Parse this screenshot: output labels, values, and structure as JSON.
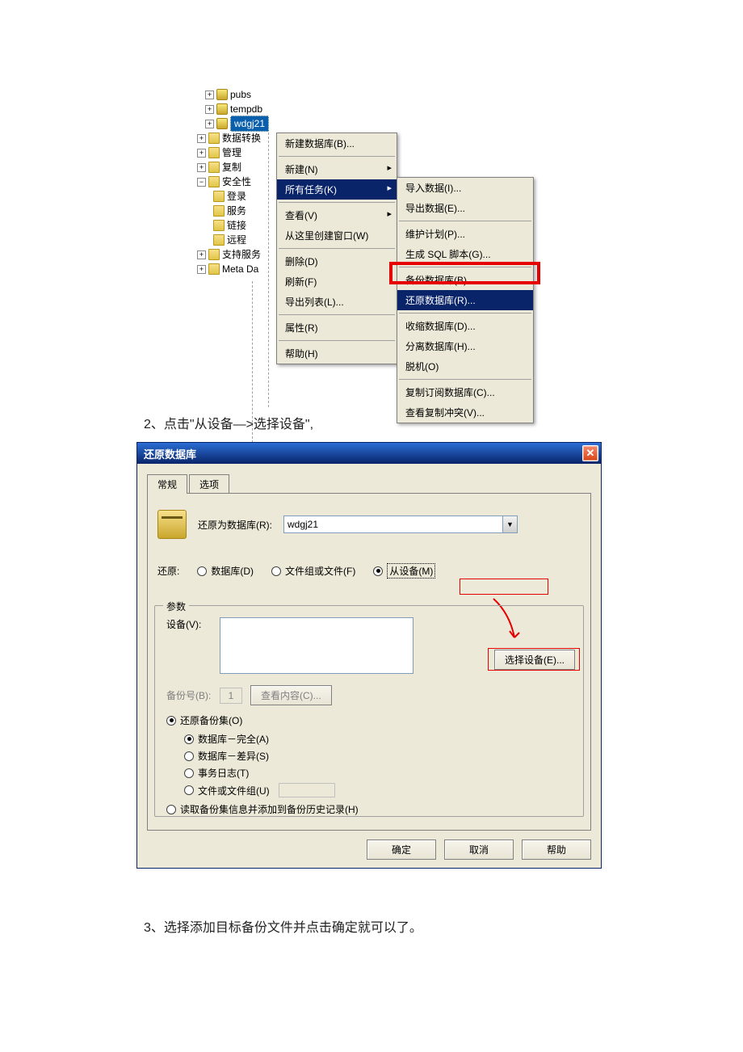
{
  "shot1": {
    "tree": {
      "pubs": "pubs",
      "tempdb": "tempdb",
      "wdgj21": "wdgj21",
      "dtx": "数据转换",
      "mgmt": "管理",
      "repl": "复制",
      "sec": "安全性",
      "login": "登录",
      "srv": "服务",
      "link": "链接",
      "remote": "远程",
      "support": "支持服务",
      "meta": "Meta Da"
    },
    "ctx1": {
      "new_db": "新建数据库(B)...",
      "new": "新建(N)",
      "all_tasks": "所有任务(K)",
      "view": "查看(V)",
      "new_window": "从这里创建窗口(W)",
      "delete": "删除(D)",
      "refresh": "刷新(F)",
      "export_list": "导出列表(L)...",
      "properties": "属性(R)",
      "help": "帮助(H)"
    },
    "ctx2": {
      "import_data": "导入数据(I)...",
      "export_data": "导出数据(E)...",
      "maint_plan": "维护计划(P)...",
      "gen_sql": "生成 SQL 脚本(G)...",
      "backup_db": "备份数据库(B)...",
      "restore_db": "还原数据库(R)...",
      "shrink_db": "收缩数据库(D)...",
      "detach_db": "分离数据库(H)...",
      "offline": "脱机(O)",
      "copy_sub": "复制订阅数据库(C)...",
      "view_conflicts": "查看复制冲突(V)..."
    }
  },
  "instr2": "2、点击\"从设备—>选择设备\",",
  "instr3": "3、选择添加目标备份文件并点击确定就可以了。",
  "shot2": {
    "title": "还原数据库",
    "tab_general": "常规",
    "tab_options": "选项",
    "restore_as_label": "还原为数据库(R):",
    "restore_as_value": "wdgj21",
    "restore_label": "还原:",
    "r_database": "数据库(D)",
    "r_filegroup": "文件组或文件(F)",
    "r_device": "从设备(M)",
    "groupbox_title": "参数",
    "devices_label": "设备(V):",
    "select_device_btn": "选择设备(E)...",
    "backup_no_label": "备份号(B):",
    "backup_no_value": "1",
    "view_contents_btn": "查看内容(C)...",
    "restore_backup_set": "还原备份集(O)",
    "db_complete": "数据库－完全(A)",
    "db_diff": "数据库－差异(S)",
    "txlog": "事务日志(T)",
    "file_or_fg": "文件或文件组(U)",
    "read_backup_info": "读取备份集信息并添加到备份历史记录(H)",
    "ok": "确定",
    "cancel": "取消",
    "help": "帮助"
  }
}
